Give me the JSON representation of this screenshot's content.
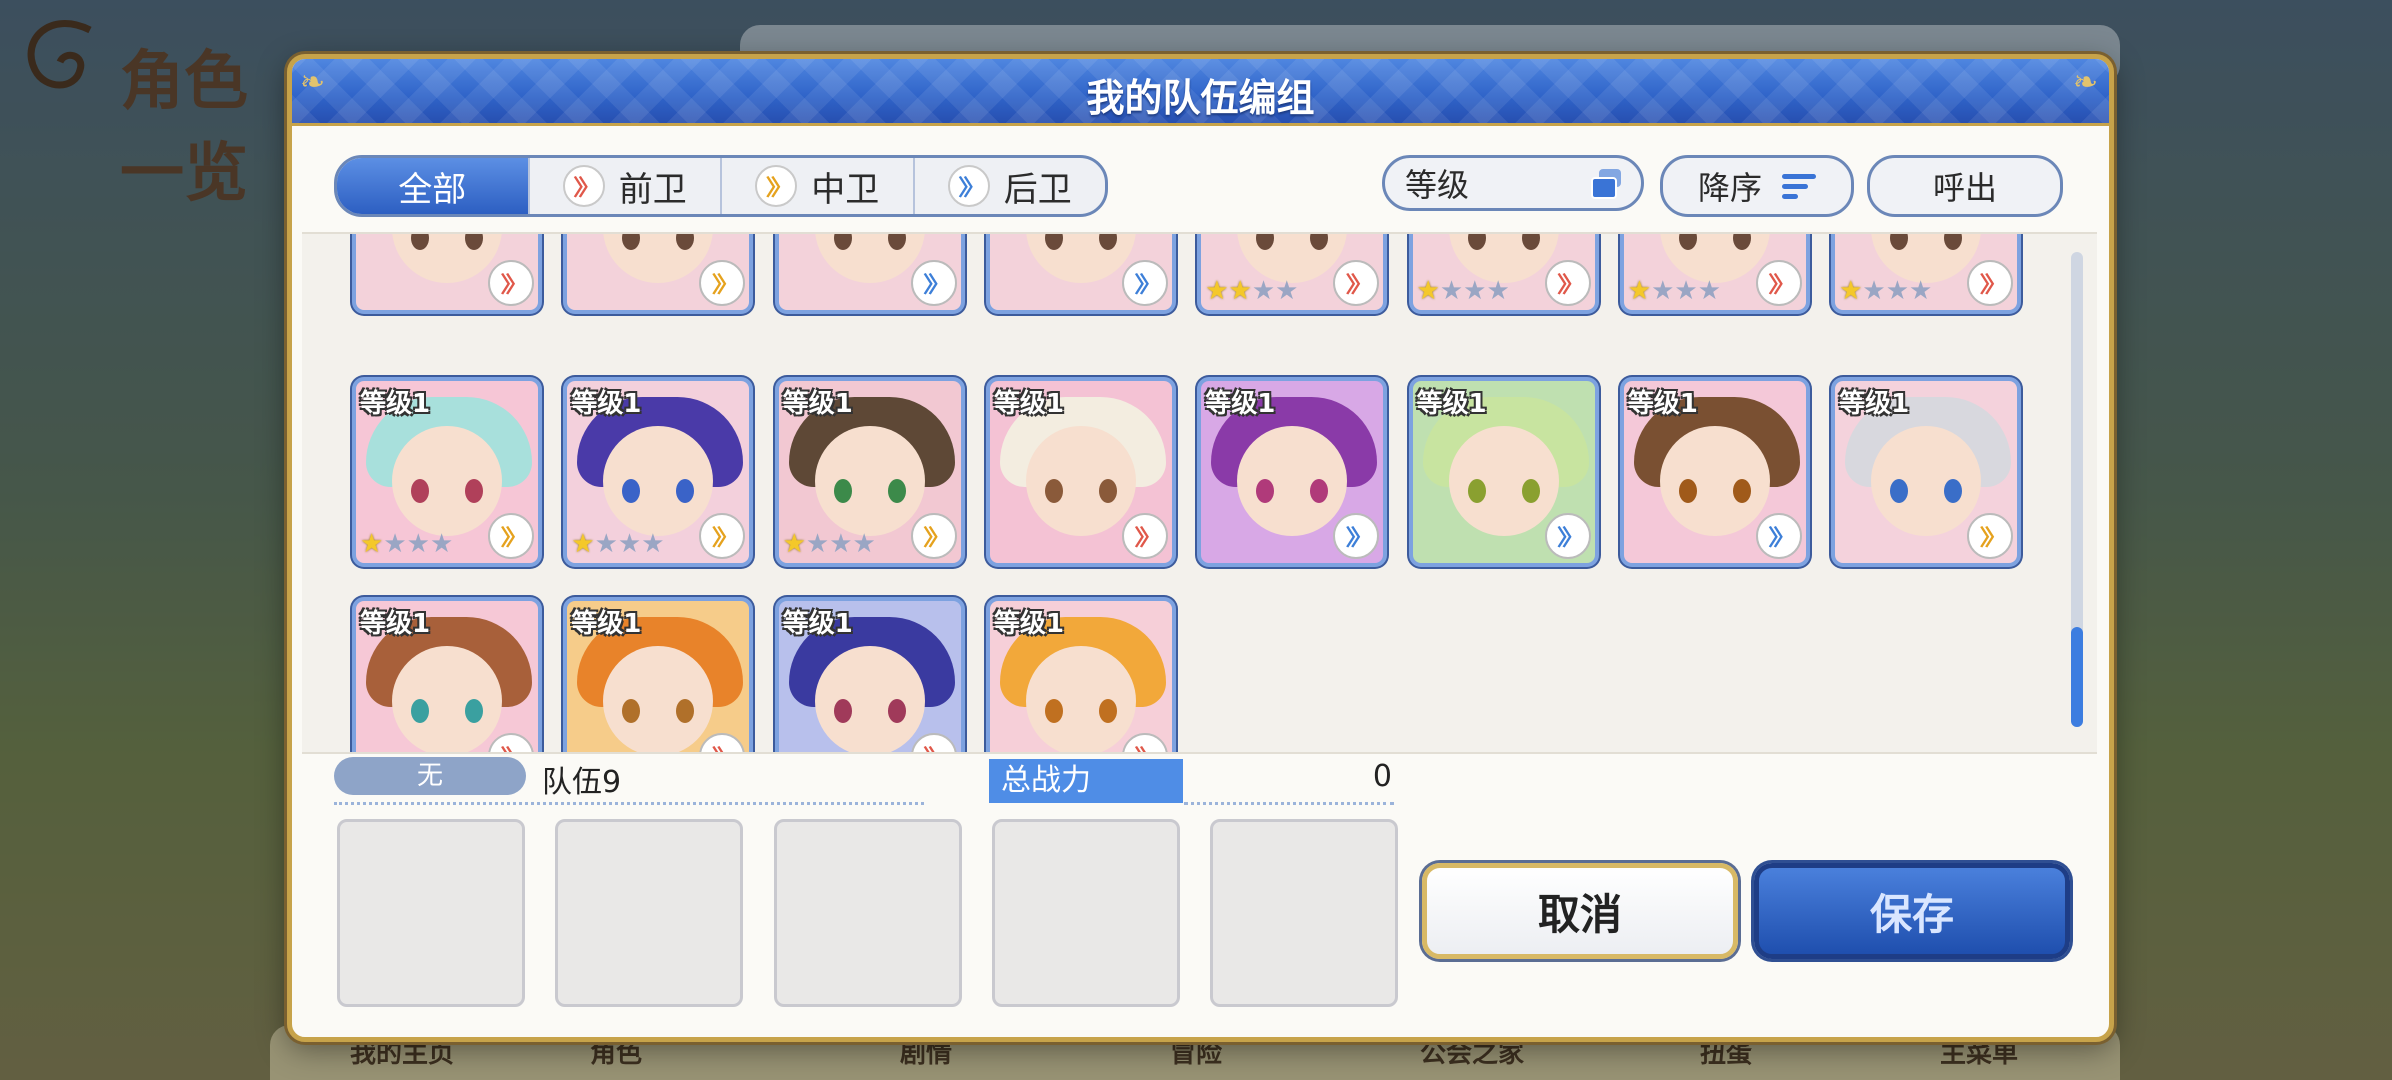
{
  "background": {
    "page_title": "角色一览",
    "bottom_nav": [
      "我的主页",
      "角色",
      "剧情",
      "冒险",
      "公会之家",
      "扭蛋",
      "主菜单"
    ]
  },
  "dialog": {
    "title": "我的队伍编组",
    "tabs": [
      {
        "label": "全部",
        "role": "none",
        "active": true
      },
      {
        "label": "前卫",
        "role": "front",
        "active": false
      },
      {
        "label": "中卫",
        "role": "middle",
        "active": false
      },
      {
        "label": "后卫",
        "role": "back",
        "active": false
      }
    ],
    "sort_label": "等级",
    "order_label": "降序",
    "call_label": "呼出"
  },
  "characters": {
    "top_row_partial": [
      {
        "stars": 0,
        "role": "front"
      },
      {
        "stars": 0,
        "role": "middle"
      },
      {
        "stars": 0,
        "role": "back"
      },
      {
        "stars": 0,
        "role": "back"
      },
      {
        "stars": 2,
        "role": "front"
      },
      {
        "stars": 1,
        "role": "front"
      },
      {
        "stars": 1,
        "role": "front"
      },
      {
        "stars": 1,
        "role": "front"
      }
    ],
    "rows": [
      [
        {
          "level": "等级1",
          "stars": 1,
          "role": "middle",
          "hair": "#a8e0dc",
          "eyes": "#b0405a",
          "bg": "#f6c6d6"
        },
        {
          "level": "等级1",
          "stars": 1,
          "role": "middle",
          "hair": "#4a3aa8",
          "eyes": "#3a63c8",
          "bg": "#f3d0dc"
        },
        {
          "level": "等级1",
          "stars": 1,
          "role": "middle",
          "hair": "#5e4836",
          "eyes": "#3c8a4a",
          "bg": "#f2c8d2"
        },
        {
          "level": "等级1",
          "stars": 0,
          "role": "front",
          "hair": "#f3ede0",
          "eyes": "#8a5a3a",
          "bg": "#f4c2d4"
        },
        {
          "level": "等级1",
          "stars": 0,
          "role": "back",
          "hair": "#8a3aa8",
          "eyes": "#b03a7a",
          "bg": "#d8a8e6"
        },
        {
          "level": "等级1",
          "stars": 0,
          "role": "back",
          "hair": "#c8e4a0",
          "eyes": "#8aa030",
          "bg": "#bfe0b0"
        },
        {
          "level": "等级1",
          "stars": 0,
          "role": "back",
          "hair": "#7a5032",
          "eyes": "#a05a1a",
          "bg": "#f4c8d8"
        },
        {
          "level": "等级1",
          "stars": 0,
          "role": "middle",
          "hair": "#d8d8de",
          "eyes": "#3a6ec8",
          "bg": "#f4d2dc"
        }
      ],
      [
        {
          "level": "等级1",
          "stars": 0,
          "role": "front",
          "hair": "#a8603a",
          "eyes": "#3aa0a0",
          "bg": "#f6c8d6"
        },
        {
          "level": "等级1",
          "stars": 0,
          "role": "front",
          "hair": "#e8832a",
          "eyes": "#b0702a",
          "bg": "#f6cc8a"
        },
        {
          "level": "等级1",
          "stars": 0,
          "role": "front",
          "hair": "#3a3aa0",
          "eyes": "#a03a5a",
          "bg": "#b8c0ec"
        },
        {
          "level": "等级1",
          "stars": 0,
          "role": "front",
          "hair": "#f2a83a",
          "eyes": "#c07020",
          "bg": "#f6cfd8"
        }
      ]
    ]
  },
  "team": {
    "tag": "无",
    "name": "队伍9",
    "power_label": "总战力",
    "power_value": "0",
    "slots": 5
  },
  "buttons": {
    "cancel": "取消",
    "save": "保存"
  },
  "colors": {
    "accent_blue": "#2f63c8",
    "gold_border": "#c7a34a",
    "role_front": "#e0584a",
    "role_middle": "#e5a21e",
    "role_back": "#3d7fd8"
  }
}
